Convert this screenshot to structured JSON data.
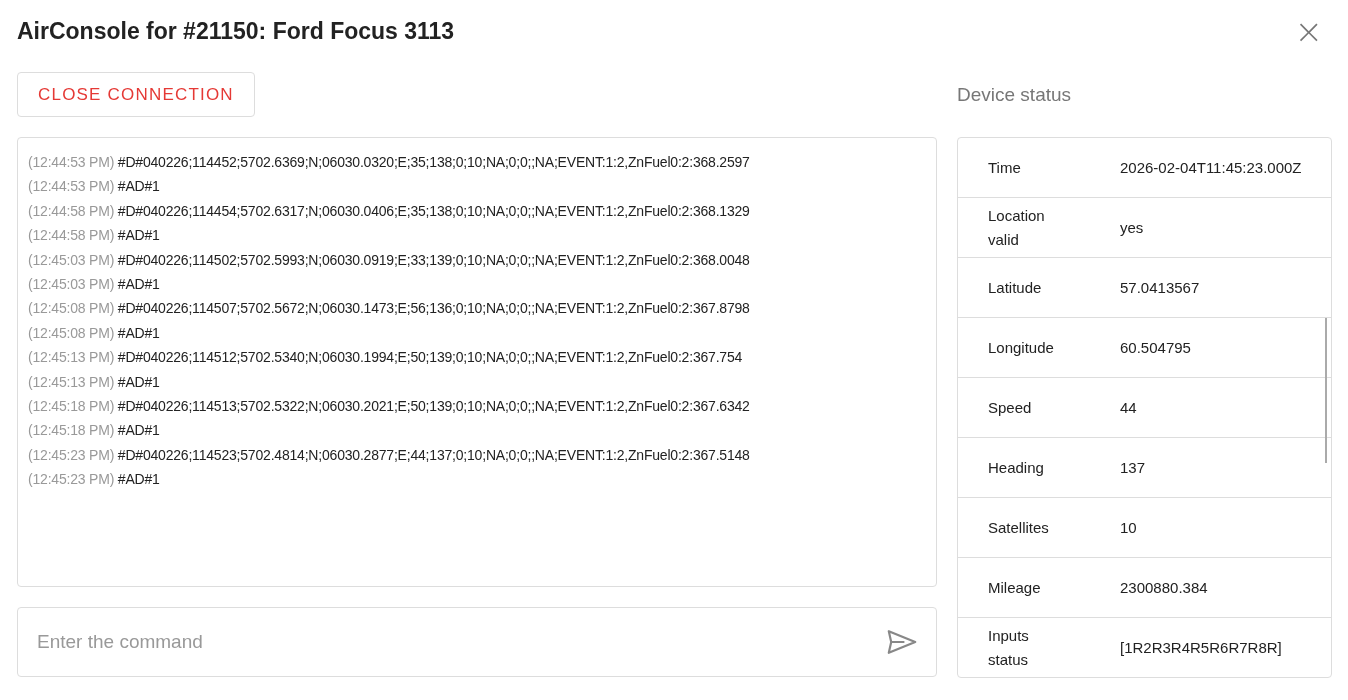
{
  "window": {
    "title": "AirConsole for #21150: Ford Focus 3113",
    "close": "×"
  },
  "close_connection": "CLOSE CONNECTION",
  "log": [
    {
      "time": "(12:44:53 PM)",
      "message": "#D#040226;114452;5702.6369;N;06030.0320;E;35;138;0;10;NA;0;0;;NA;EVENT:1:2,ZnFuel0:2:368.2597"
    },
    {
      "time": "(12:44:53 PM)",
      "message": "#AD#1"
    },
    {
      "time": "(12:44:58 PM)",
      "message": "#D#040226;114454;5702.6317;N;06030.0406;E;35;138;0;10;NA;0;0;;NA;EVENT:1:2,ZnFuel0:2:368.1329"
    },
    {
      "time": "(12:44:58 PM)",
      "message": "#AD#1"
    },
    {
      "time": "(12:45:03 PM)",
      "message": "#D#040226;114502;5702.5993;N;06030.0919;E;33;139;0;10;NA;0;0;;NA;EVENT:1:2,ZnFuel0:2:368.0048"
    },
    {
      "time": "(12:45:03 PM)",
      "message": "#AD#1"
    },
    {
      "time": "(12:45:08 PM)",
      "message": "#D#040226;114507;5702.5672;N;06030.1473;E;56;136;0;10;NA;0;0;;NA;EVENT:1:2,ZnFuel0:2:367.8798"
    },
    {
      "time": "(12:45:08 PM)",
      "message": "#AD#1"
    },
    {
      "time": "(12:45:13 PM)",
      "message": "#D#040226;114512;5702.5340;N;06030.1994;E;50;139;0;10;NA;0;0;;NA;EVENT:1:2,ZnFuel0:2:367.754"
    },
    {
      "time": "(12:45:13 PM)",
      "message": "#AD#1"
    },
    {
      "time": "(12:45:18 PM)",
      "message": "#D#040226;114513;5702.5322;N;06030.2021;E;50;139;0;10;NA;0;0;;NA;EVENT:1:2,ZnFuel0:2:367.6342"
    },
    {
      "time": "(12:45:18 PM)",
      "message": "#AD#1"
    },
    {
      "time": "(12:45:23 PM)",
      "message": "#D#040226;114523;5702.4814;N;06030.2877;E;44;137;0;10;NA;0;0;;NA;EVENT:1:2,ZnFuel0:2:367.5148"
    },
    {
      "time": "(12:45:23 PM)",
      "message": "#AD#1"
    }
  ],
  "command_input": {
    "placeholder": "Enter the command"
  },
  "device_status": {
    "title": "Device status",
    "rows": [
      {
        "label": "Time",
        "value": "2026-02-04T11:45:23.000Z"
      },
      {
        "label": "Location valid",
        "value": "yes"
      },
      {
        "label": "Latitude",
        "value": "57.0413567"
      },
      {
        "label": "Longitude",
        "value": "60.504795"
      },
      {
        "label": "Speed",
        "value": "44"
      },
      {
        "label": "Heading",
        "value": "137"
      },
      {
        "label": "Satellites",
        "value": "10"
      },
      {
        "label": "Mileage",
        "value": "2300880.384"
      },
      {
        "label": "Inputs status",
        "value": "[1R2R3R4R5R6R7R8R]"
      }
    ]
  }
}
